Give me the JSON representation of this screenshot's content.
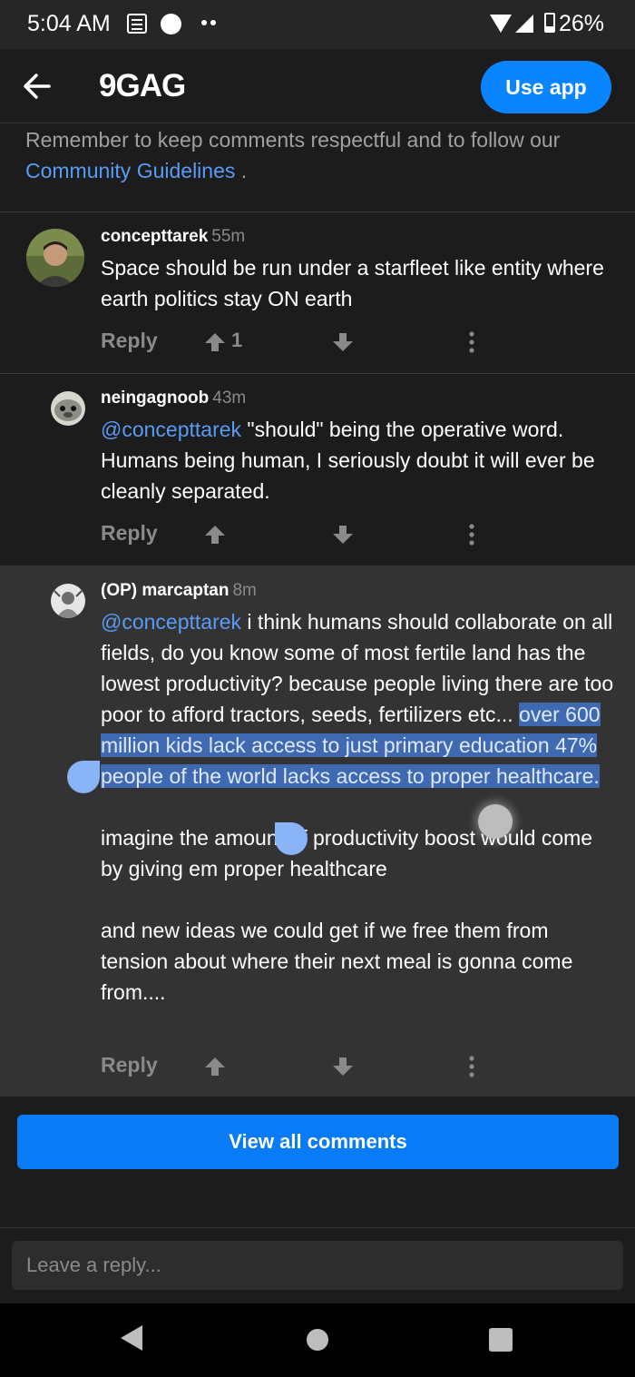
{
  "status_bar": {
    "time": "5:04 AM",
    "battery": "26%"
  },
  "header": {
    "logo": "9GAG",
    "use_app_label": "Use app"
  },
  "notice": {
    "text": "Remember to keep comments respectful and to follow our ",
    "link": "Community Guidelines",
    "suffix": " ."
  },
  "comments": [
    {
      "user": "concepttarek",
      "time": "55m",
      "text": "Space should be run under a starfleet like entity where earth politics stay ON earth",
      "reply_label": "Reply",
      "upvotes": "1"
    },
    {
      "user": "neingagnoob",
      "time": "43m",
      "mention": "@concepttarek",
      "text": " \"should\" being the operative word. Humans being human, I seriously doubt it will ever be cleanly separated.",
      "reply_label": "Reply"
    },
    {
      "user": "(OP) marcaptan",
      "time": "8m",
      "mention": "@concepttarek",
      "text_before": " i think humans should collaborate on all fields, do you know some of most fertile land has the lowest productivity? because people living there are too poor to afford tractors, seeds, fertilizers etc... ",
      "text_selected": "over 600 million kids lack access to just primary education 47% people of the world lacks access to proper healthcare.",
      "para2": "imagine the amount of productivity boost would come by giving em proper healthcare",
      "para3": "and new ideas we could get if we free them from tension about where their next meal is gonna come from....",
      "reply_label": "Reply"
    }
  ],
  "view_all_label": "View all comments",
  "reply_input": {
    "placeholder": "Leave a reply..."
  },
  "colors": {
    "accent": "#0a84ff",
    "link": "#5a9bf6",
    "selection": "#3f6ab2"
  }
}
